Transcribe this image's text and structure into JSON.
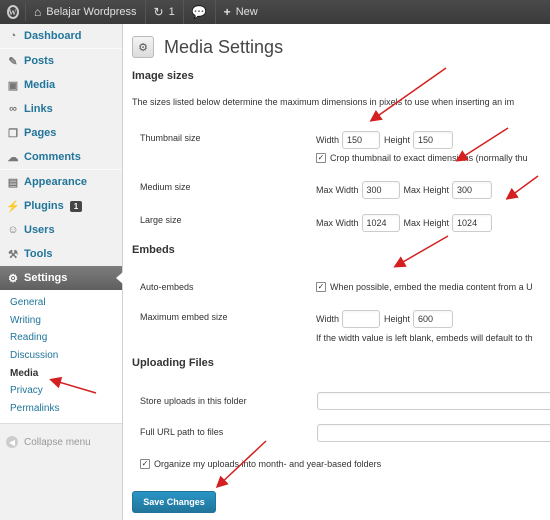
{
  "adminbar": {
    "site_name": "Belajar Wordpress",
    "updates_count": "1",
    "new_label": "New"
  },
  "sidebar": {
    "items": [
      {
        "label": "Dashboard",
        "icon": "dashboard-icon"
      },
      {
        "label": "Posts",
        "icon": "pushpin-icon"
      },
      {
        "label": "Media",
        "icon": "media-icon"
      },
      {
        "label": "Links",
        "icon": "link-icon"
      },
      {
        "label": "Pages",
        "icon": "pages-icon"
      },
      {
        "label": "Comments",
        "icon": "comment-icon"
      },
      {
        "label": "Appearance",
        "icon": "appearance-icon"
      },
      {
        "label": "Plugins",
        "icon": "plugin-icon",
        "badge": "1"
      },
      {
        "label": "Users",
        "icon": "users-icon"
      },
      {
        "label": "Tools",
        "icon": "tools-icon"
      },
      {
        "label": "Settings",
        "icon": "settings-icon"
      }
    ],
    "submenu": [
      "General",
      "Writing",
      "Reading",
      "Discussion",
      "Media",
      "Privacy",
      "Permalinks"
    ],
    "collapse_label": "Collapse menu"
  },
  "page": {
    "title": "Media Settings",
    "image_sizes": {
      "heading": "Image sizes",
      "description": "The sizes listed below determine the maximum dimensions in pixels to use when inserting an im",
      "thumbnail_label": "Thumbnail size",
      "width_label": "Width",
      "height_label": "Height",
      "thumb_width": "150",
      "thumb_height": "150",
      "crop_label": "Crop thumbnail to exact dimensions (normally thu",
      "medium_label": "Medium size",
      "max_width_label": "Max Width",
      "max_height_label": "Max Height",
      "medium_width": "300",
      "medium_height": "300",
      "large_label": "Large size",
      "large_width": "1024",
      "large_height": "1024"
    },
    "embeds": {
      "heading": "Embeds",
      "auto_label": "Auto-embeds",
      "auto_text": "When possible, embed the media content from a U",
      "max_label": "Maximum embed size",
      "width_label": "Width",
      "height_label": "Height",
      "width_value": "",
      "height_value": "600",
      "note": "If the width value is left blank, embeds will default to th"
    },
    "uploading": {
      "heading": "Uploading Files",
      "store_label": "Store uploads in this folder",
      "store_value": "",
      "url_label": "Full URL path to files",
      "url_value": "",
      "organize_label": "Organize my uploads into month- and year-based folders"
    },
    "save_label": "Save Changes"
  },
  "colors": {
    "adminbar": "#464646",
    "link": "#21759b",
    "primary_button": "#21759b",
    "annotation_arrow": "#d42020"
  }
}
